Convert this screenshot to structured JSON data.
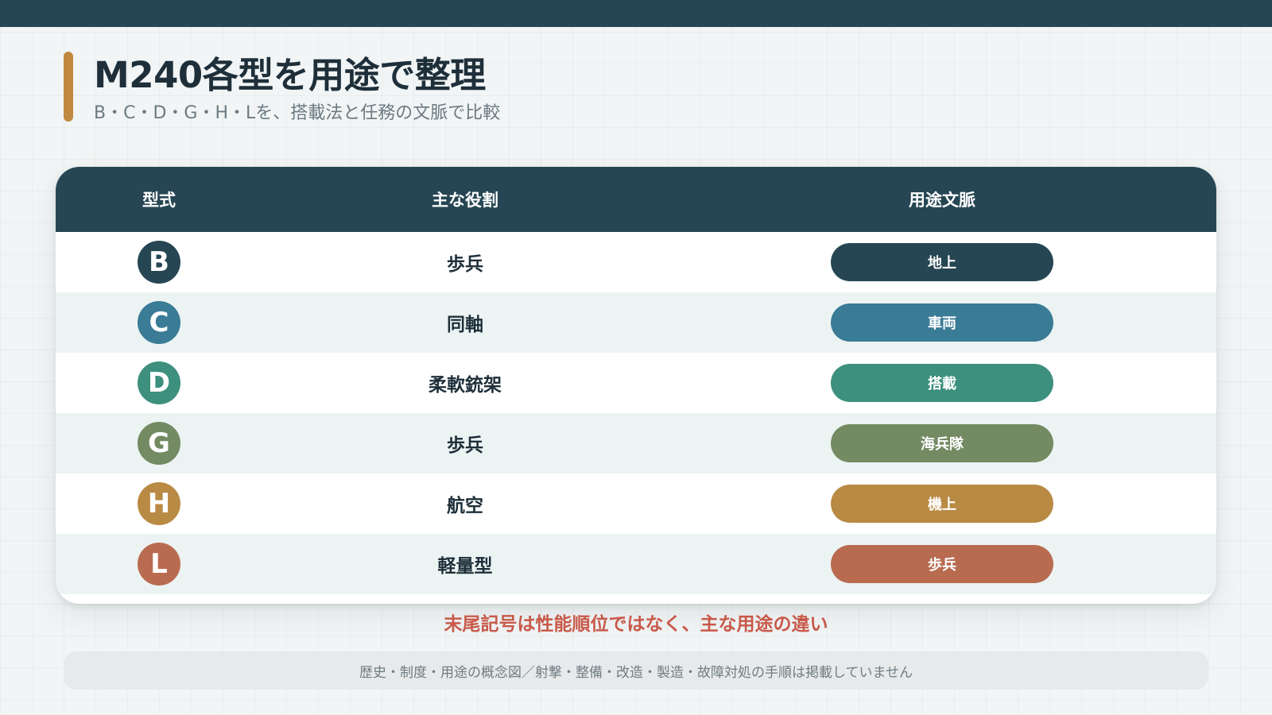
{
  "title": "M240各型を用途で整理",
  "subtitle": "B・C・D・G・H・Lを、搭載法と任務の文脈で比較",
  "table": {
    "headers": {
      "model": "型式",
      "role": "主な役割",
      "context": "用途文脈"
    },
    "rows": [
      {
        "model": "B",
        "role": "歩兵",
        "context": "地上",
        "color": "#264653"
      },
      {
        "model": "C",
        "role": "同軸",
        "context": "車両",
        "color": "#3a7b96"
      },
      {
        "model": "D",
        "role": "柔軟銃架",
        "context": "搭載",
        "color": "#3d8f7e"
      },
      {
        "model": "G",
        "role": "歩兵",
        "context": "海兵隊",
        "color": "#738a62"
      },
      {
        "model": "H",
        "role": "航空",
        "context": "機上",
        "color": "#b98a44"
      },
      {
        "model": "L",
        "role": "軽量型",
        "context": "歩兵",
        "color": "#b96b50"
      }
    ]
  },
  "note": "末尾記号は性能順位ではなく、主な用途の違い",
  "footer": "歴史・制度・用途の概念図／射撃・整備・改造・製造・故障対処の手順は掲載していません",
  "colors": {
    "header_bg": "#264653",
    "accent": "#c1893f",
    "note": "#c8594a"
  }
}
